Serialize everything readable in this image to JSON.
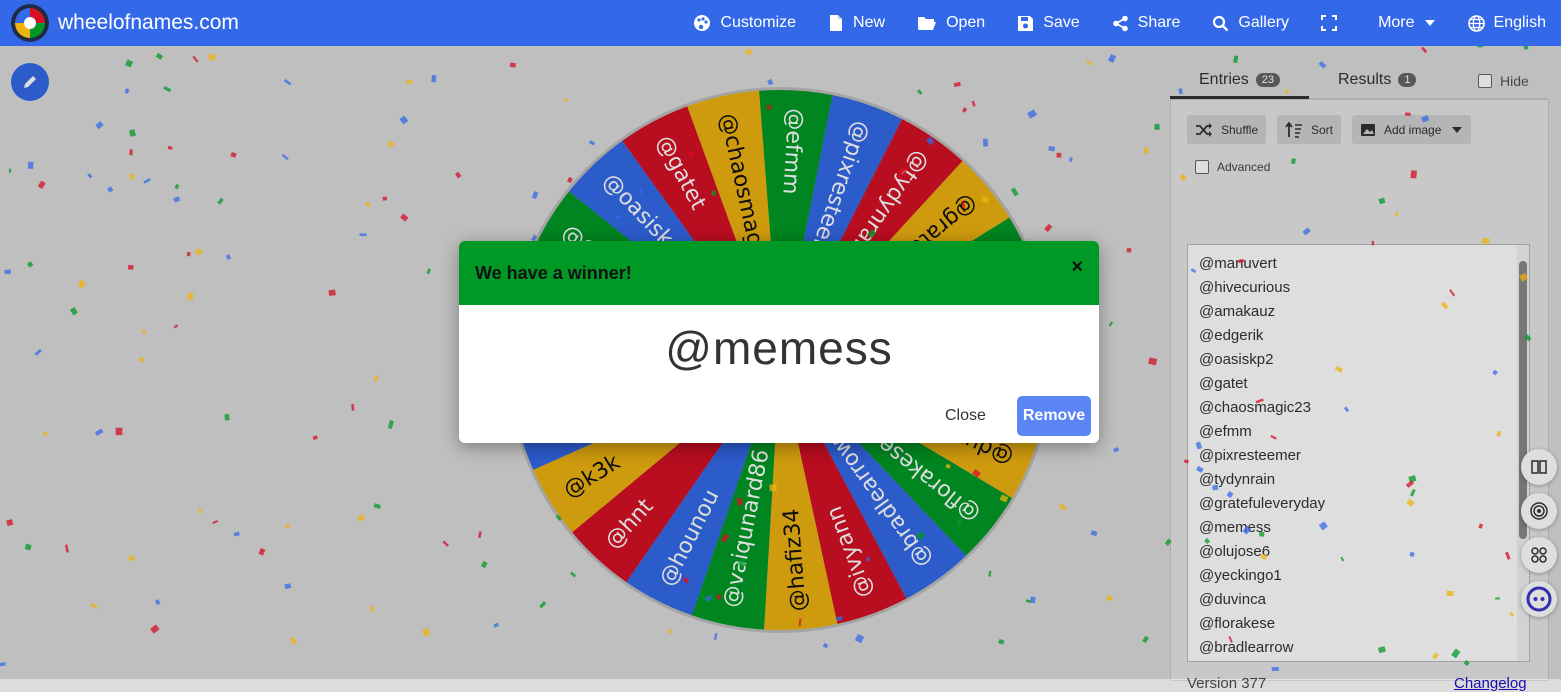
{
  "header": {
    "site_name": "wheelofnames.com",
    "nav": [
      {
        "label": "Customize",
        "icon": "palette-icon"
      },
      {
        "label": "New",
        "icon": "file-icon"
      },
      {
        "label": "Open",
        "icon": "folder-open-icon"
      },
      {
        "label": "Save",
        "icon": "floppy-icon"
      },
      {
        "label": "Share",
        "icon": "share-icon"
      },
      {
        "label": "Gallery",
        "icon": "search-icon"
      },
      {
        "label": "",
        "icon": "fullscreen-icon"
      },
      {
        "label": "More",
        "icon": "caret-down-icon"
      },
      {
        "label": "English",
        "icon": "globe-icon"
      }
    ]
  },
  "wheel": {
    "colors": [
      "#3369e8",
      "#d50f25",
      "#eeb211",
      "#009925"
    ],
    "segments": [
      "@manuvert",
      "@hivecurious",
      "@amakauz",
      "@edgerik",
      "@oasiskp2",
      "@gatet",
      "@chaosmagic23",
      "@efmm",
      "@pixresteemer",
      "@tydynrain",
      "@gratefuleveryday",
      "@memess",
      "@olujose6",
      "@yeckingo1",
      "@duvinca",
      "@florakese",
      "@bradlearrow",
      "@ivyann",
      "@hafiz34",
      "@vaiqunard86",
      "@hounou",
      "@hnt",
      "@k3k"
    ]
  },
  "panel": {
    "tabs": {
      "entries_label": "Entries",
      "entries_count": "23",
      "results_label": "Results",
      "results_count": "1"
    },
    "hide_label": "Hide",
    "buttons": {
      "shuffle": "Shuffle",
      "sort": "Sort",
      "add_image": "Add image"
    },
    "advanced_label": "Advanced",
    "entries": [
      "@manuvert",
      "@hivecurious",
      "@amakauz",
      "@edgerik",
      "@oasiskp2",
      "@gatet",
      "@chaosmagic23",
      "@efmm",
      "@pixresteemer",
      "@tydynrain",
      "@gratefuleveryday",
      "@memess",
      "@olujose6",
      "@yeckingo1",
      "@duvinca",
      "@florakese",
      "@bradlearrow"
    ],
    "version": "Version 377",
    "changelog": "Changelog"
  },
  "dialog": {
    "title": "We have a winner!",
    "winner": "@memess",
    "close_label": "Close",
    "remove_label": "Remove",
    "close_icon": "×"
  },
  "side_widgets": [
    "book-icon",
    "broadcast-icon",
    "apps-icon",
    "assistant-icon"
  ]
}
